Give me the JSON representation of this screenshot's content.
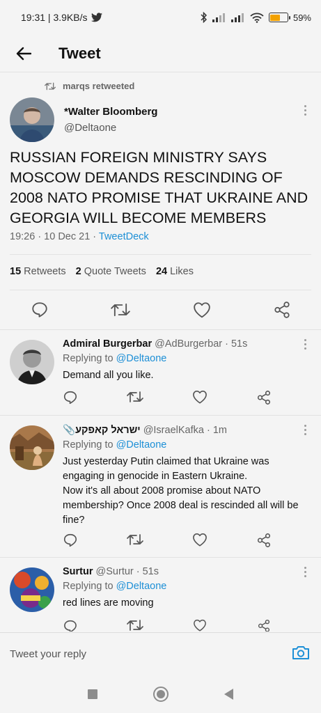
{
  "status_bar": {
    "time_speed": "19:31 | 3.9KB/s",
    "battery": "59%",
    "battery_level": 0.59
  },
  "header": {
    "title": "Tweet"
  },
  "main_tweet": {
    "retweeted_by": "marqs retweeted",
    "display_name": "*Walter Bloomberg",
    "handle": "@Deltaone",
    "text": "RUSSIAN FOREIGN MINISTRY SAYS MOSCOW DEMANDS RESCINDING OF 2008 NATO PROMISE THAT UKRAINE AND GEORGIA WILL BECOME MEMBERS",
    "time": "19:26 · 10 Dec 21 · ",
    "source": "TweetDeck",
    "retweets_count": "15",
    "retweets_label": "Retweets",
    "quotes_count": "2",
    "quotes_label": "Quote Tweets",
    "likes_count": "24",
    "likes_label": "Likes"
  },
  "replies": [
    {
      "display_name": "Admiral Burgerbar",
      "handle_time": "@AdBurgerbar · 51s",
      "replying_prefix": "Replying to ",
      "replying_to": "@Deltaone",
      "text": "Demand all you like."
    },
    {
      "display_name": "📎ישראל קאפקע",
      "handle_time": "@IsraelKafka · 1m",
      "replying_prefix": "Replying to ",
      "replying_to": "@Deltaone",
      "text": "Just yesterday Putin claimed that Ukraine was engaging in genocide in Eastern Ukraine.\nNow it's all about 2008 promise about NATO membership? Once 2008 deal is rescinded all will be fine?"
    },
    {
      "display_name": "Surtur",
      "handle_time": "@Surtur · 51s",
      "replying_prefix": "Replying to ",
      "replying_to": "@Deltaone",
      "text": "red lines are moving"
    }
  ],
  "reply_bar": {
    "placeholder": "Tweet your reply"
  },
  "colors": {
    "accent": "#1d8fd6",
    "background": "#f4f4f4",
    "battery": "#f2a100"
  },
  "icons": [
    "twitter-icon",
    "bluetooth-icon",
    "signal-icon",
    "wifi-icon",
    "battery-icon",
    "back-arrow-icon",
    "retweet-icon",
    "more-icon",
    "reply-icon",
    "like-icon",
    "share-icon",
    "camera-icon"
  ]
}
